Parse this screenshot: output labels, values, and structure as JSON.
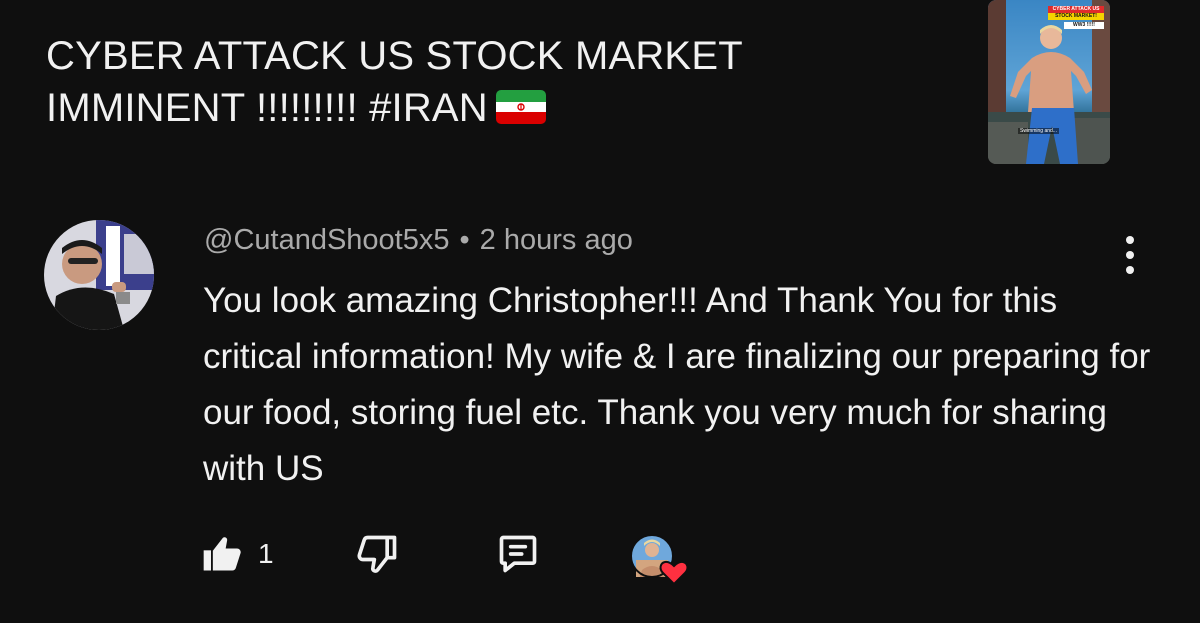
{
  "video": {
    "title": "CYBER ATTACK US STOCK MARKET IMMINENT !!!!!!!!! #IRAN",
    "flag_icon": "iran-flag-icon",
    "thumbnail": {
      "badge_line1": "CYBER ATTACK US",
      "badge_line2": "STOCK MARKET!",
      "badge_line3": "WW3 !!!!!",
      "caption": "Swimming and..."
    }
  },
  "comment": {
    "author": "@CutandShoot5x5",
    "separator": "•",
    "time": "2 hours ago",
    "text": "You look amazing Christopher!!! And Thank You for this critical information! My wife & I are finalizing our preparing for our food, storing fuel etc. Thank you very much for sharing with US",
    "like_count": "1",
    "icons": {
      "like": "thumbs-up-icon",
      "dislike": "thumbs-down-icon",
      "reply": "reply-comment-icon",
      "more": "more-vert-icon",
      "creator_heart": "creator-heart-icon"
    }
  },
  "colors": {
    "background": "#0f0f0f",
    "primary_text": "#f1f1f1",
    "secondary_text": "#aaaaaa",
    "heart": "#ff3040"
  }
}
